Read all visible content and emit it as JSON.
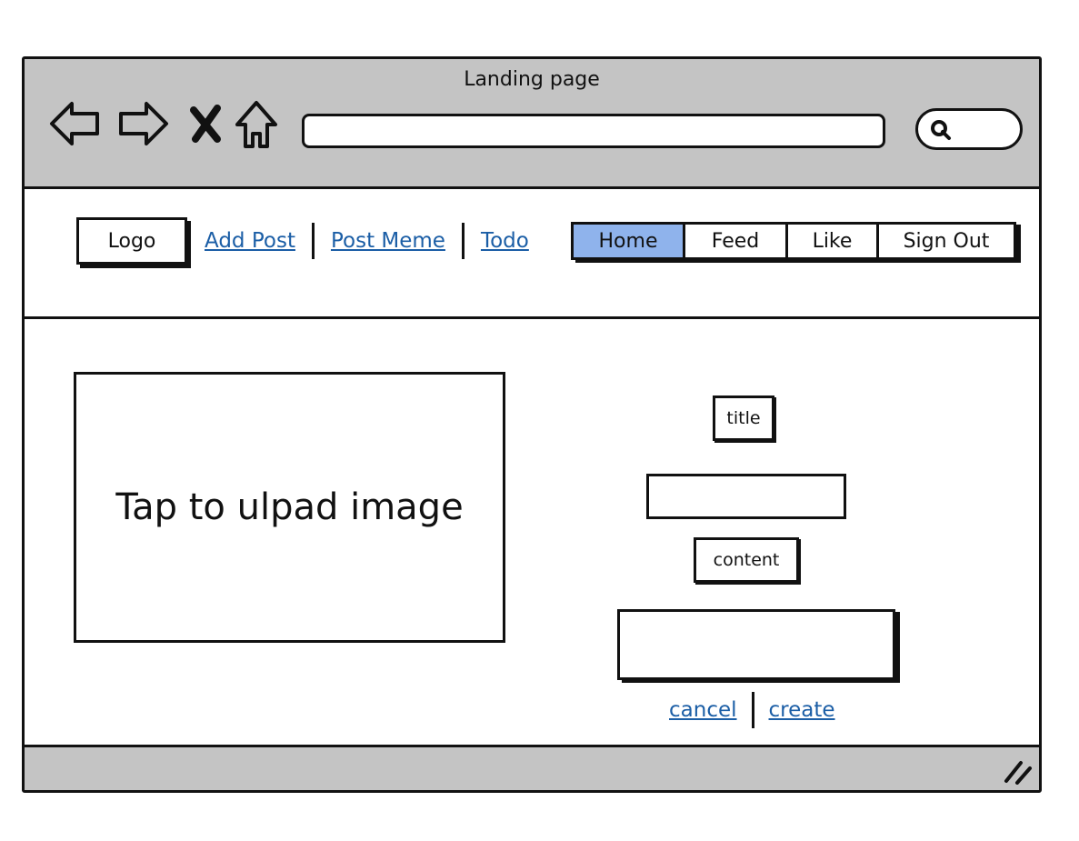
{
  "window": {
    "title": "Landing page"
  },
  "browser": {
    "nav_icons": [
      "back-arrow-icon",
      "forward-arrow-icon",
      "close-icon",
      "home-icon"
    ],
    "url_value": "",
    "search_icon": "search-icon"
  },
  "header": {
    "logo": "Logo",
    "links": [
      "Add Post",
      "Post Meme",
      "Todo"
    ],
    "tabs": [
      "Home",
      "Feed",
      "Like",
      "Sign Out"
    ],
    "active_tab": "Home",
    "active_color": "#8fb3ec"
  },
  "main": {
    "image_upload_label": "Tap to ulpad image",
    "title_label": "title",
    "title_value": "",
    "content_label": "content",
    "content_value": "",
    "cancel_label": "cancel",
    "create_label": "create"
  },
  "colors": {
    "chrome": "#c4c4c4",
    "link": "#1b5ea6"
  },
  "statusbar": {
    "resize_icon": "resize-grip-icon"
  }
}
